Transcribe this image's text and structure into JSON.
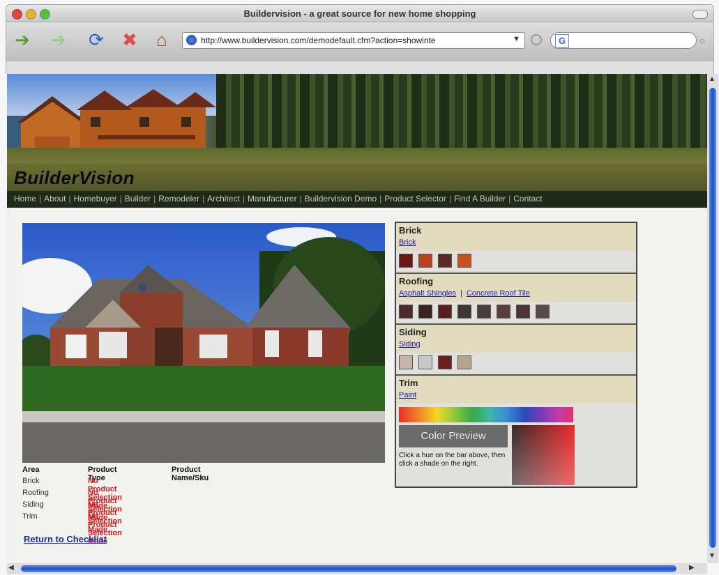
{
  "window": {
    "title": "Buildervision - a great source for new home shopping"
  },
  "toolbar": {
    "url": "http://www.buildervision.com/demodefault.cfm?action=showinte",
    "url_dropdown": "▼",
    "search_placeholder": ""
  },
  "icons": {
    "back": "back-arrow-icon",
    "forward": "forward-arrow-icon",
    "reload": "reload-icon",
    "stop": "stop-icon",
    "home": "home-icon",
    "site": "globe-icon",
    "search_engine": "search-engine-icon"
  },
  "site": {
    "logo_prefix": "Builder",
    "logo_suffix": "Vision",
    "nav": [
      "Home",
      "About",
      "Homebuyer",
      "Builder",
      "Remodeler",
      "Architect",
      "Manufacturer",
      "Buildervision Demo",
      "Product Selector",
      "Find A Builder",
      "Contact"
    ]
  },
  "selection": {
    "headers": {
      "area": "Area",
      "type": "Product Type",
      "name": "Product Name/Sku"
    },
    "rows": [
      {
        "area": "Brick",
        "status": "No Product Selection Made"
      },
      {
        "area": "Roofing",
        "status": "No Product Selection Made"
      },
      {
        "area": "Siding",
        "status": "No Product Selection Made"
      },
      {
        "area": "Trim",
        "status": "No Product Selection Made"
      }
    ],
    "return_link": "Return to Checklist"
  },
  "panel": {
    "brick": {
      "title": "Brick",
      "link": "Brick",
      "swatches": [
        "#6a1a14",
        "#b8441e",
        "#5a2a24",
        "#c8501e"
      ]
    },
    "roofing": {
      "title": "Roofing",
      "link1": "Asphalt Shingles",
      "link2": "Concrete Roof Tile",
      "separator": "|",
      "swatches": [
        "#4a2a26",
        "#3a2420",
        "#5a1e1e",
        "#3e3434",
        "#4a3e3a",
        "#5a3e3a",
        "#4a3434",
        "#5a4a4a"
      ]
    },
    "siding": {
      "title": "Siding",
      "link": "Siding",
      "swatches": [
        "#c8b4a8",
        "#c8c8c8",
        "#6a1e1e",
        "#b8a48a"
      ]
    },
    "trim": {
      "title": "Trim",
      "link": "Paint"
    },
    "preview_label": "Color Preview",
    "hint": "Click a hue on the bar above, then click a shade on the right."
  },
  "colors": {
    "nav_bg": "#1e2a1a",
    "link_blue": "#1a1aa8",
    "warning_red": "#d41a1a",
    "scroll_blue": "#1a52c8"
  }
}
